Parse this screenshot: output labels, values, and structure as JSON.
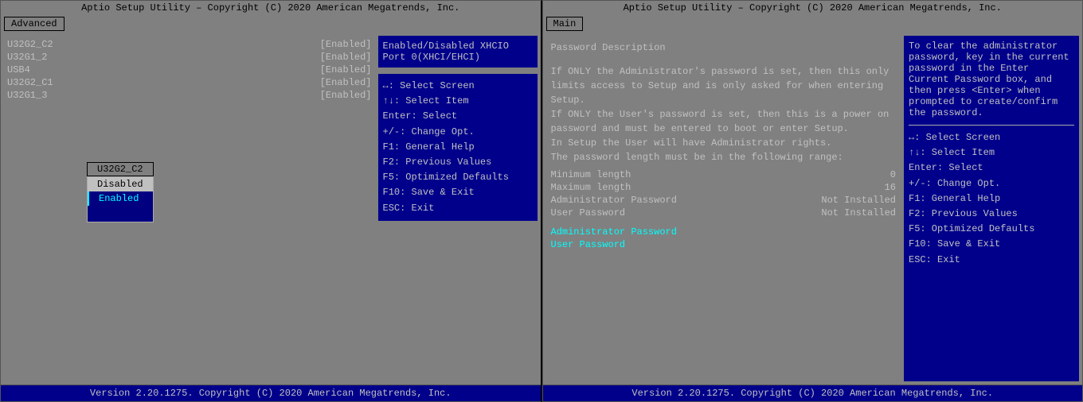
{
  "left_screen": {
    "header": "Aptio Setup Utility – Copyright (C) 2020 American Megatrends, Inc.",
    "tab": "Advanced",
    "menu_items": [
      {
        "name": "U32G2_C2",
        "value": "[Enabled]"
      },
      {
        "name": "U32G1_2",
        "value": "[Enabled]"
      },
      {
        "name": "USB4",
        "value": "[Enabled]"
      },
      {
        "name": "U32G2_C1",
        "value": "[Enabled]"
      },
      {
        "name": "U32G1_3",
        "value": "[Enabled]"
      }
    ],
    "dropdown": {
      "title": "U32G2_C2",
      "options": [
        {
          "label": "Disabled",
          "state": "highlighted"
        },
        {
          "label": "Enabled",
          "state": "selected"
        }
      ]
    },
    "right_desc": "Enabled/Disabled XHCIO Port 0(XHCI/EHCI)",
    "shortcuts": [
      "↔: Select Screen",
      "↑↓: Select Item",
      "Enter: Select",
      "+/-: Change Opt.",
      "F1: General Help",
      "F2: Previous Values",
      "F5: Optimized Defaults",
      "F10: Save & Exit",
      "ESC: Exit"
    ],
    "footer": "Version 2.20.1275. Copyright (C) 2020 American Megatrends, Inc."
  },
  "right_screen": {
    "header": "Aptio Setup Utility – Copyright (C) 2020 American Megatrends, Inc.",
    "tab": "Main",
    "password_desc_lines": [
      "Password Description",
      "",
      "If ONLY the Administrator's password is set, then this only",
      "limits access to Setup and is only asked for when entering",
      "Setup.",
      "If ONLY the User's password is set, then this is a power on",
      "password and must be entered to boot or enter Setup.",
      "In Setup the User will have Administrator rights.",
      "The password length must be in the following range:"
    ],
    "password_stats": [
      {
        "label": "Minimum length",
        "value": "0"
      },
      {
        "label": "Maximum length",
        "value": "16"
      },
      {
        "label": "Administrator Password",
        "value": "Not Installed"
      },
      {
        "label": "User Password",
        "value": "Not Installed"
      }
    ],
    "password_actions": [
      "Administrator Password",
      "User Password"
    ],
    "right_desc": "To clear the administrator password, key in the current password in the Enter Current Password box, and then press <Enter> when prompted to create/confirm the password.",
    "shortcuts": [
      "↔: Select Screen",
      "↑↓: Select Item",
      "Enter: Select",
      "+/-: Change Opt.",
      "F1: General Help",
      "F2: Previous Values",
      "F5: Optimized Defaults",
      "F10: Save & Exit",
      "ESC: Exit"
    ],
    "footer": "Version 2.20.1275. Copyright (C) 2020 American Megatrends, Inc."
  }
}
